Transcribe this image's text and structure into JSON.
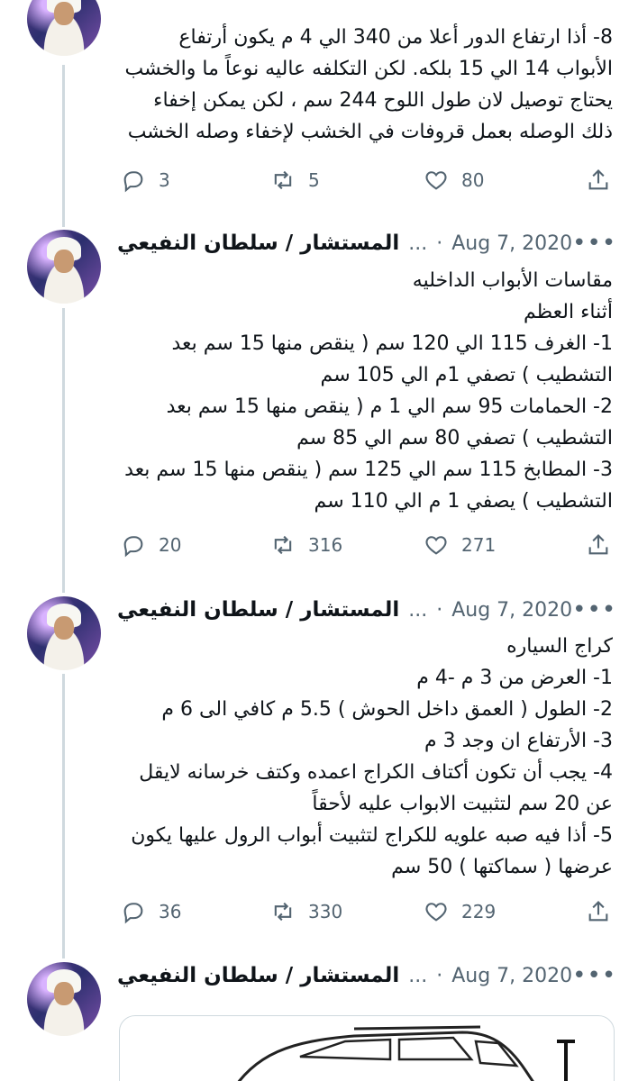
{
  "tweets": [
    {
      "text": "8- أذا ارتفاع الدور أعلا من 340 الي 4 م يكون أرتفاع الأبواب 14 الي 15 بلكه. لكن التكلفه عاليه نوعاً ما والخشب يحتاج توصيل لان طول اللوح 244 سم ، لكن يمكن إخفاء ذلك الوصله بعمل قروفات في الخشب لإخفاء وصله الخشب",
      "replies": "3",
      "retweets": "5",
      "likes": "80"
    },
    {
      "author": "المستشار / سلطان النفيعي",
      "handle": "...",
      "date": "Aug 7, 2020",
      "text": "مقاسات الأبواب الداخليه\nأثناء العظم\n1- الغرف 115 الي 120 سم ( ينقص منها 15 سم بعد التشطيب ) تصفي 1م الي 105 سم\n2- الحمامات 95 سم الي 1 م ( ينقص منها 15 سم بعد التشطيب ) تصفي 80 سم الي 85 سم\n3- المطابخ 115 سم الي 125 سم ( ينقص منها 15 سم بعد التشطيب ) يصفي 1 م الي 110 سم",
      "replies": "20",
      "retweets": "316",
      "likes": "271"
    },
    {
      "author": "المستشار / سلطان النفيعي",
      "handle": "...",
      "date": "Aug 7, 2020",
      "text": "كراج السياره\n1- العرض من 3 م -4 م\n2- الطول ( العمق داخل الحوش )  5.5 م كافي الى 6 م\n3- الأرتفاع ان وجد 3 م\n4- يجب أن تكون أكتاف الكراج اعمده وكتف خرسانه لايقل عن 20 سم لتثبيت الابواب عليه لأحقاً\n5- أذا فيه صبه علويه للكراج لتثبيت أبواب الرول عليها يكون عرضها ( سماكتها ) 50 سم",
      "replies": "36",
      "retweets": "330",
      "likes": "229"
    },
    {
      "author": "المستشار / سلطان النفيعي",
      "handle": "...",
      "date": "Aug 7, 2020"
    }
  ],
  "icons": {
    "reply": "reply-icon",
    "retweet": "retweet-icon",
    "like": "heart-icon",
    "share": "share-icon",
    "more": "more-icon"
  },
  "colors": {
    "text": "#0f1419",
    "secondary": "#536471",
    "thread_line": "#cfd9de"
  }
}
